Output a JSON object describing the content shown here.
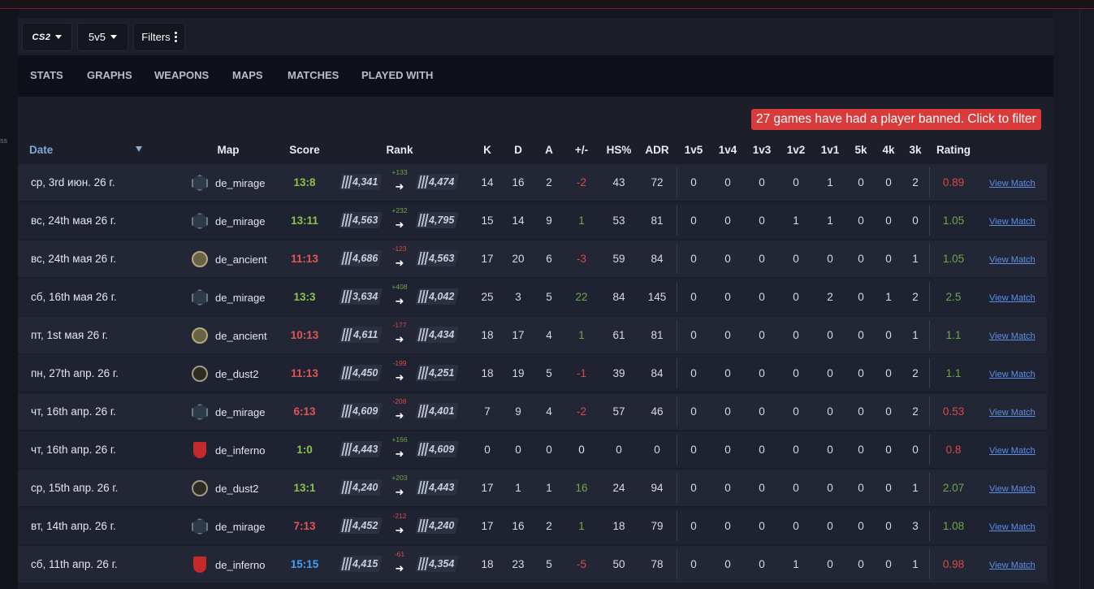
{
  "toolbar": {
    "game": "CS2",
    "mode": "5v5",
    "filters": "Filters"
  },
  "tabs": [
    "STATS",
    "GRAPHS",
    "WEAPONS",
    "MAPS",
    "MATCHES",
    "PLAYED WITH"
  ],
  "banned_notice": "27 games have had a player banned. Click to filter",
  "left_cutoff_text": "ss",
  "columns": {
    "date": "Date",
    "map": "Map",
    "score": "Score",
    "rank": "Rank",
    "k": "K",
    "d": "D",
    "a": "A",
    "pm": "+/-",
    "hs": "HS%",
    "adr": "ADR",
    "c1v5": "1v5",
    "c1v4": "1v4",
    "c1v3": "1v3",
    "c1v2": "1v2",
    "c1v1": "1v1",
    "k5": "5k",
    "k4": "4k",
    "k3": "3k",
    "rating": "Rating"
  },
  "view_label": "View Match",
  "colors": {
    "win": "#8bc34a",
    "loss": "#e05656",
    "tie": "#3ba3ff",
    "positive": "#6fa84a",
    "negative": "#d94a4a",
    "link": "#5b8fe8",
    "banner": "#d93a3a"
  },
  "matches": [
    {
      "date": "ср, 3rd июн. 26 г.",
      "map": "de_mirage",
      "map_icon": "mirage-icon",
      "score": "13:8",
      "result": "win",
      "rank_before": "4,341",
      "rank_diff": "+133",
      "rank_after": "4,474",
      "k": "14",
      "d": "16",
      "a": "2",
      "pm": "-2",
      "hs": "43",
      "adr": "72",
      "c1v5": "0",
      "c1v4": "0",
      "c1v3": "0",
      "c1v2": "0",
      "c1v1": "1",
      "k5": "0",
      "k4": "0",
      "k3": "2",
      "rating": "0.89"
    },
    {
      "date": "вс, 24th мая 26 г.",
      "map": "de_mirage",
      "map_icon": "mirage-icon",
      "score": "13:11",
      "result": "win",
      "rank_before": "4,563",
      "rank_diff": "+232",
      "rank_after": "4,795",
      "k": "15",
      "d": "14",
      "a": "9",
      "pm": "1",
      "hs": "53",
      "adr": "81",
      "c1v5": "0",
      "c1v4": "0",
      "c1v3": "0",
      "c1v2": "1",
      "c1v1": "1",
      "k5": "0",
      "k4": "0",
      "k3": "0",
      "rating": "1.05"
    },
    {
      "date": "вс, 24th мая 26 г.",
      "map": "de_ancient",
      "map_icon": "ancient-icon",
      "score": "11:13",
      "result": "loss",
      "rank_before": "4,686",
      "rank_diff": "-123",
      "rank_after": "4,563",
      "k": "17",
      "d": "20",
      "a": "6",
      "pm": "-3",
      "hs": "59",
      "adr": "84",
      "c1v5": "0",
      "c1v4": "0",
      "c1v3": "0",
      "c1v2": "0",
      "c1v1": "0",
      "k5": "0",
      "k4": "0",
      "k3": "1",
      "rating": "1.05"
    },
    {
      "date": "сб, 16th мая 26 г.",
      "map": "de_mirage",
      "map_icon": "mirage-icon",
      "score": "13:3",
      "result": "win",
      "rank_before": "3,634",
      "rank_diff": "+408",
      "rank_after": "4,042",
      "k": "25",
      "d": "3",
      "a": "5",
      "pm": "22",
      "hs": "84",
      "adr": "145",
      "c1v5": "0",
      "c1v4": "0",
      "c1v3": "0",
      "c1v2": "0",
      "c1v1": "2",
      "k5": "0",
      "k4": "1",
      "k3": "2",
      "rating": "2.5"
    },
    {
      "date": "пт, 1st мая 26 г.",
      "map": "de_ancient",
      "map_icon": "ancient-icon",
      "score": "10:13",
      "result": "loss",
      "rank_before": "4,611",
      "rank_diff": "-177",
      "rank_after": "4,434",
      "k": "18",
      "d": "17",
      "a": "4",
      "pm": "1",
      "hs": "61",
      "adr": "81",
      "c1v5": "0",
      "c1v4": "0",
      "c1v3": "0",
      "c1v2": "0",
      "c1v1": "0",
      "k5": "0",
      "k4": "0",
      "k3": "1",
      "rating": "1.1"
    },
    {
      "date": "пн, 27th апр. 26 г.",
      "map": "de_dust2",
      "map_icon": "dust2-icon",
      "score": "11:13",
      "result": "loss",
      "rank_before": "4,450",
      "rank_diff": "-199",
      "rank_after": "4,251",
      "k": "18",
      "d": "19",
      "a": "5",
      "pm": "-1",
      "hs": "39",
      "adr": "84",
      "c1v5": "0",
      "c1v4": "0",
      "c1v3": "0",
      "c1v2": "0",
      "c1v1": "0",
      "k5": "0",
      "k4": "0",
      "k3": "2",
      "rating": "1.1"
    },
    {
      "date": "чт, 16th апр. 26 г.",
      "map": "de_mirage",
      "map_icon": "mirage-icon",
      "score": "6:13",
      "result": "loss",
      "rank_before": "4,609",
      "rank_diff": "-208",
      "rank_after": "4,401",
      "k": "7",
      "d": "9",
      "a": "4",
      "pm": "-2",
      "hs": "57",
      "adr": "46",
      "c1v5": "0",
      "c1v4": "0",
      "c1v3": "0",
      "c1v2": "0",
      "c1v1": "0",
      "k5": "0",
      "k4": "0",
      "k3": "2",
      "rating": "0.53"
    },
    {
      "date": "чт, 16th апр. 26 г.",
      "map": "de_inferno",
      "map_icon": "inferno-icon",
      "score": "1:0",
      "result": "win",
      "rank_before": "4,443",
      "rank_diff": "+166",
      "rank_after": "4,609",
      "k": "0",
      "d": "0",
      "a": "0",
      "pm": "0",
      "hs": "0",
      "adr": "0",
      "c1v5": "0",
      "c1v4": "0",
      "c1v3": "0",
      "c1v2": "0",
      "c1v1": "0",
      "k5": "0",
      "k4": "0",
      "k3": "0",
      "rating": "0.8"
    },
    {
      "date": "ср, 15th апр. 26 г.",
      "map": "de_dust2",
      "map_icon": "dust2-icon",
      "score": "13:1",
      "result": "win",
      "rank_before": "4,240",
      "rank_diff": "+203",
      "rank_after": "4,443",
      "k": "17",
      "d": "1",
      "a": "1",
      "pm": "16",
      "hs": "24",
      "adr": "94",
      "c1v5": "0",
      "c1v4": "0",
      "c1v3": "0",
      "c1v2": "0",
      "c1v1": "0",
      "k5": "0",
      "k4": "0",
      "k3": "1",
      "rating": "2.07"
    },
    {
      "date": "вт, 14th апр. 26 г.",
      "map": "de_mirage",
      "map_icon": "mirage-icon",
      "score": "7:13",
      "result": "loss",
      "rank_before": "4,452",
      "rank_diff": "-212",
      "rank_after": "4,240",
      "k": "17",
      "d": "16",
      "a": "2",
      "pm": "1",
      "hs": "18",
      "adr": "79",
      "c1v5": "0",
      "c1v4": "0",
      "c1v3": "0",
      "c1v2": "0",
      "c1v1": "0",
      "k5": "0",
      "k4": "0",
      "k3": "3",
      "rating": "1.08"
    },
    {
      "date": "сб, 11th апр. 26 г.",
      "map": "de_inferno",
      "map_icon": "inferno-icon",
      "score": "15:15",
      "result": "tie",
      "rank_before": "4,415",
      "rank_diff": "-61",
      "rank_after": "4,354",
      "k": "18",
      "d": "23",
      "a": "5",
      "pm": "-5",
      "hs": "50",
      "adr": "78",
      "c1v5": "0",
      "c1v4": "0",
      "c1v3": "0",
      "c1v2": "1",
      "c1v1": "0",
      "k5": "0",
      "k4": "0",
      "k3": "1",
      "rating": "0.98"
    }
  ]
}
